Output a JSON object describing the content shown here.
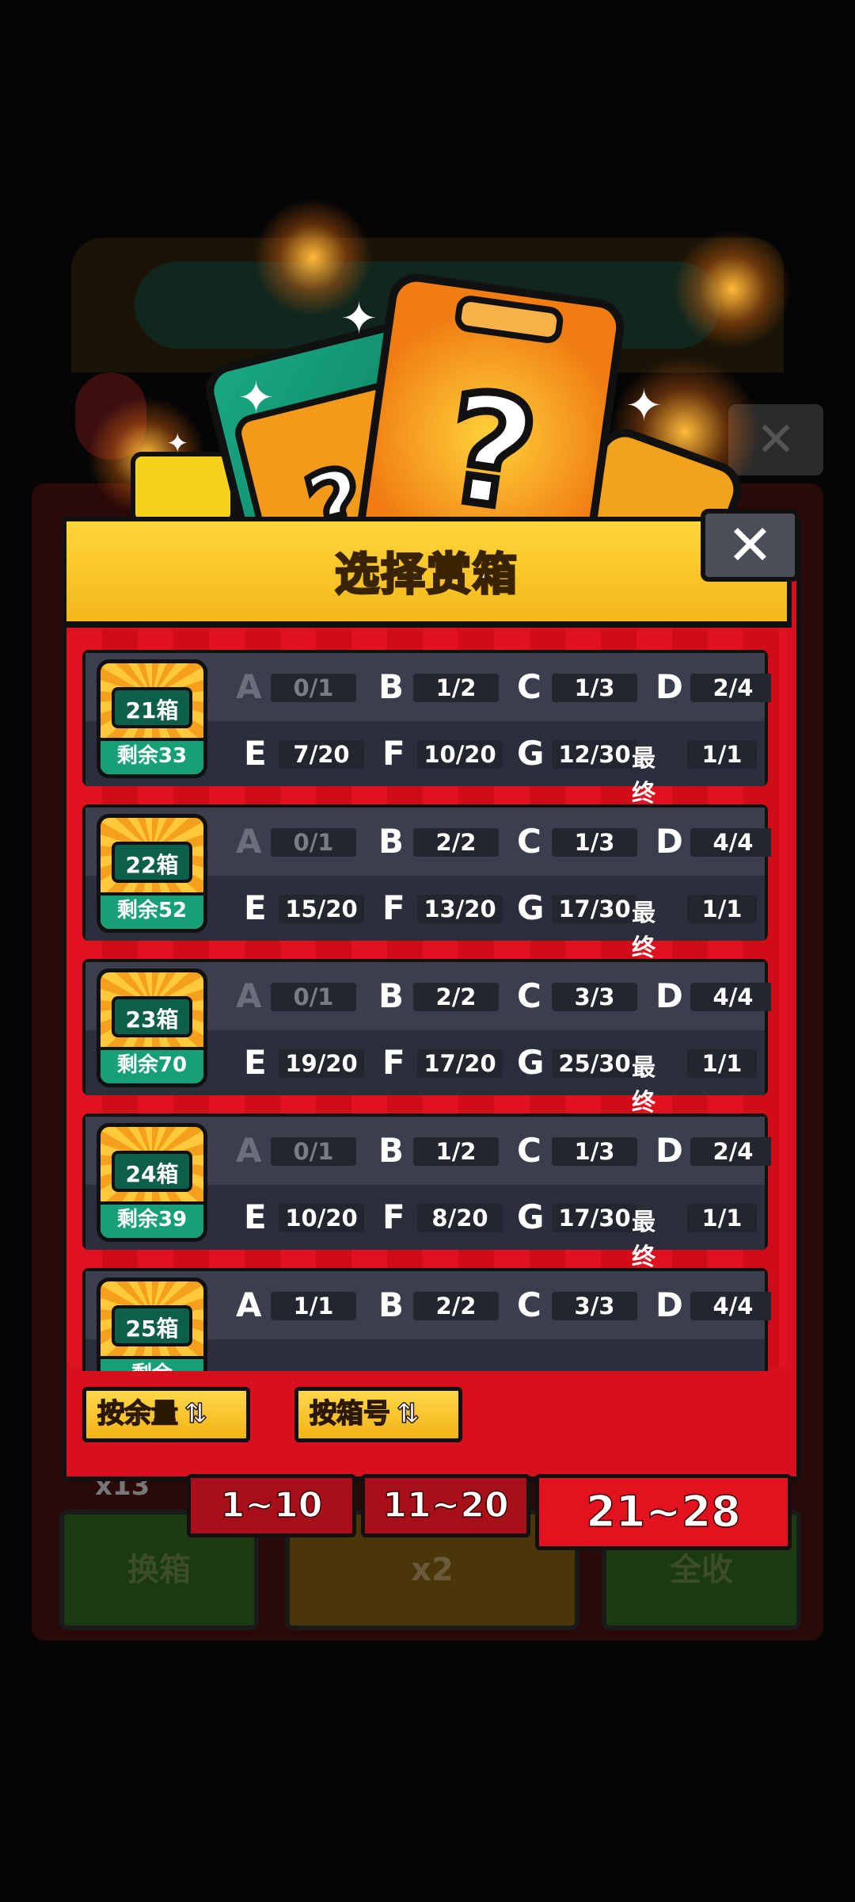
{
  "dialog": {
    "title": "选择赏箱",
    "close_icon": "close-icon"
  },
  "background": {
    "count_text": "x13",
    "buttons": [
      "换箱",
      "x2",
      "全收"
    ]
  },
  "rows": [
    {
      "box_label": "21箱",
      "remaining": "剩余33",
      "top": [
        {
          "letter": "A",
          "count": "0/1",
          "dim": true
        },
        {
          "letter": "B",
          "count": "1/2",
          "dim": false
        },
        {
          "letter": "C",
          "count": "1/3",
          "dim": false
        },
        {
          "letter": "D",
          "count": "2/4",
          "dim": false
        }
      ],
      "bottom": [
        {
          "letter": "E",
          "count": "7/20"
        },
        {
          "letter": "F",
          "count": "10/20"
        },
        {
          "letter": "G",
          "count": "12/30"
        }
      ],
      "final_label": "最终",
      "final_count": "1/1"
    },
    {
      "box_label": "22箱",
      "remaining": "剩余52",
      "top": [
        {
          "letter": "A",
          "count": "0/1",
          "dim": true
        },
        {
          "letter": "B",
          "count": "2/2",
          "dim": false
        },
        {
          "letter": "C",
          "count": "1/3",
          "dim": false
        },
        {
          "letter": "D",
          "count": "4/4",
          "dim": false
        }
      ],
      "bottom": [
        {
          "letter": "E",
          "count": "15/20"
        },
        {
          "letter": "F",
          "count": "13/20"
        },
        {
          "letter": "G",
          "count": "17/30"
        }
      ],
      "final_label": "最终",
      "final_count": "1/1"
    },
    {
      "box_label": "23箱",
      "remaining": "剩余70",
      "top": [
        {
          "letter": "A",
          "count": "0/1",
          "dim": true
        },
        {
          "letter": "B",
          "count": "2/2",
          "dim": false
        },
        {
          "letter": "C",
          "count": "3/3",
          "dim": false
        },
        {
          "letter": "D",
          "count": "4/4",
          "dim": false
        }
      ],
      "bottom": [
        {
          "letter": "E",
          "count": "19/20"
        },
        {
          "letter": "F",
          "count": "17/20"
        },
        {
          "letter": "G",
          "count": "25/30"
        }
      ],
      "final_label": "最终",
      "final_count": "1/1"
    },
    {
      "box_label": "24箱",
      "remaining": "剩余39",
      "top": [
        {
          "letter": "A",
          "count": "0/1",
          "dim": true
        },
        {
          "letter": "B",
          "count": "1/2",
          "dim": false
        },
        {
          "letter": "C",
          "count": "1/3",
          "dim": false
        },
        {
          "letter": "D",
          "count": "2/4",
          "dim": false
        }
      ],
      "bottom": [
        {
          "letter": "E",
          "count": "10/20"
        },
        {
          "letter": "F",
          "count": "8/20"
        },
        {
          "letter": "G",
          "count": "17/30"
        }
      ],
      "final_label": "最终",
      "final_count": "1/1"
    },
    {
      "box_label": "25箱",
      "remaining": "剩余",
      "top": [
        {
          "letter": "A",
          "count": "1/1",
          "dim": false
        },
        {
          "letter": "B",
          "count": "2/2",
          "dim": false
        },
        {
          "letter": "C",
          "count": "3/3",
          "dim": false
        },
        {
          "letter": "D",
          "count": "4/4",
          "dim": false
        }
      ],
      "bottom": [],
      "final_label": "",
      "final_count": ""
    }
  ],
  "sort_buttons": [
    {
      "label": "按余量",
      "icon": "swap-vertical-icon"
    },
    {
      "label": "按箱号",
      "icon": "swap-vertical-icon"
    }
  ],
  "page_tabs": [
    {
      "label": "1~10",
      "active": false
    },
    {
      "label": "11~20",
      "active": false
    },
    {
      "label": "21~28",
      "active": true
    }
  ],
  "colors": {
    "dialog_red": "#d80f1c",
    "header_yellow": "#f4b71a",
    "row_dark": "#2f3341",
    "box_green": "#17a077"
  }
}
